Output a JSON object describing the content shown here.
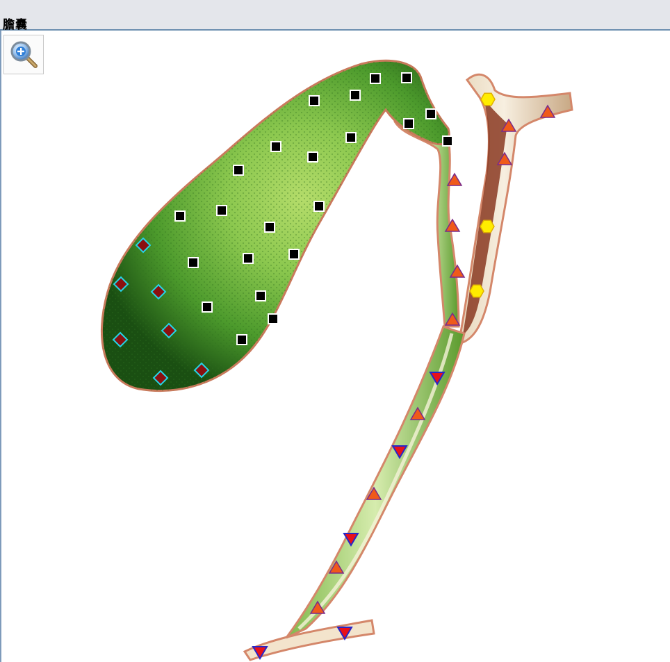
{
  "panel": {
    "title": "膽囊"
  },
  "toolbar": {
    "zoom_in_icon": "magnifier-plus-icon"
  },
  "colors": {
    "gallbladder_dark": "#1f5a16",
    "gallbladder_light": "#8cc84f",
    "duct_outline": "#d4876a",
    "duct_inner": "#f2e6d2",
    "hepatic_duct_dark": "#8a3a22",
    "square_marker_fill": "#000000",
    "square_marker_border": "#ffffff",
    "diamond_marker_fill": "#8b1010",
    "diamond_marker_border": "#25d4e8",
    "triangle_up_fill": "#ef5a1a",
    "triangle_up_border": "#7a2a8a",
    "triangle_down_fill": "#e8111a",
    "triangle_down_border": "#2727c8",
    "hexagon_fill": "#ffec00",
    "hexagon_border": "#e0b000"
  }
}
